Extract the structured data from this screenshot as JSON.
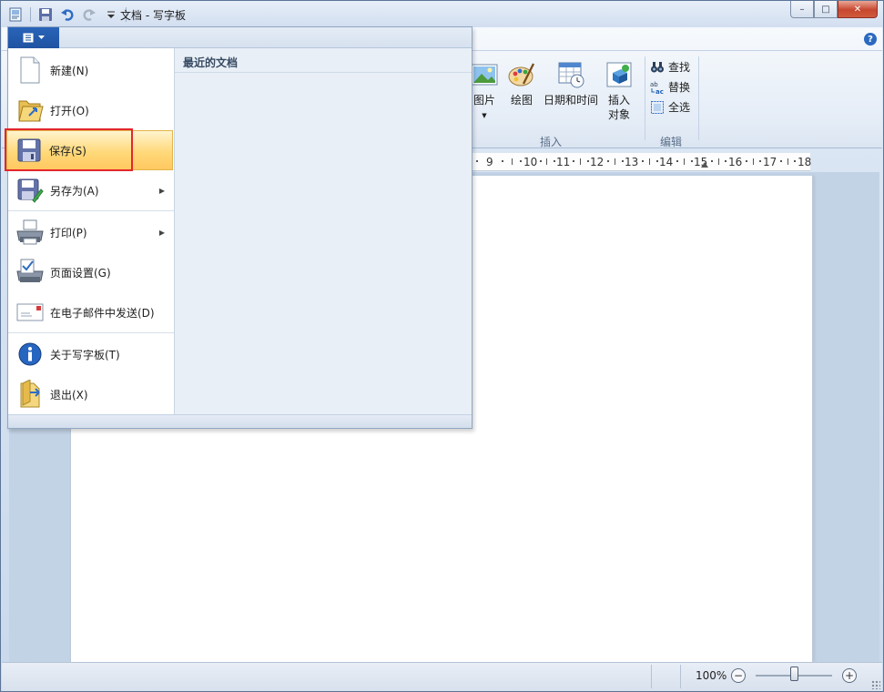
{
  "window": {
    "title_doc": "文档",
    "title_sep": " - ",
    "title_app": "写字板"
  },
  "qat": {
    "icons": [
      "app-icon",
      "save-icon",
      "undo-icon",
      "redo-icon",
      "customize-dropdown-icon"
    ]
  },
  "caption": {
    "minimize": "–",
    "maximize": "□",
    "close": "✕"
  },
  "ribbon": {
    "help": "?",
    "insert_group": {
      "picture": "图片",
      "paint": "绘图",
      "datetime": "日期和时间",
      "object_line1": "插入",
      "object_line2": "对象",
      "label": "插入"
    },
    "edit_group": {
      "find": "查找",
      "replace": "替换",
      "select_all": "全选",
      "label": "编辑"
    }
  },
  "ruler": {
    "numbers": [
      "9",
      "10",
      "11",
      "12",
      "13",
      "14",
      "15",
      "16",
      "17",
      "18"
    ]
  },
  "app_menu": {
    "recent_title": "最近的文档",
    "items": [
      {
        "label": "新建(N)",
        "icon": "new-document-icon"
      },
      {
        "label": "打开(O)",
        "icon": "open-folder-icon"
      },
      {
        "label": "保存(S)",
        "icon": "save-icon",
        "selected": true
      },
      {
        "label": "另存为(A)",
        "icon": "save-as-icon",
        "submenu": true
      },
      {
        "label": "打印(P)",
        "icon": "print-icon",
        "submenu": true
      },
      {
        "label": "页面设置(G)",
        "icon": "page-setup-icon"
      },
      {
        "label": "在电子邮件中发送(D)",
        "icon": "email-icon"
      },
      {
        "label": "关于写字板(T)",
        "icon": "info-icon"
      },
      {
        "label": "退出(X)",
        "icon": "exit-icon"
      }
    ]
  },
  "statusbar": {
    "zoom": "100%",
    "zoom_out": "−",
    "zoom_in": "+"
  },
  "colors": {
    "selection_fill": "#ffd97a",
    "highlight_box": "#e3262c",
    "menu_button": "#1f53a2"
  }
}
